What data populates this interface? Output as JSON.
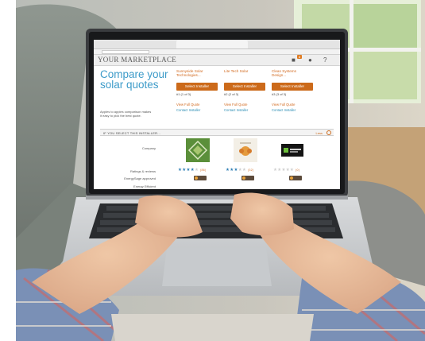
{
  "marketplace": {
    "brand": "YOUR MARKETPLACE",
    "header_icons": [
      "chat-icon",
      "lock-icon",
      "help-icon"
    ],
    "notification_count": "8",
    "title_line1": "Compare your",
    "title_line2": "solar quotes",
    "intro_line1": "Apples to apples comparison makes",
    "intro_line2": "it easy to pick the best quote.",
    "installers": [
      {
        "name_line1": "Sunnyside Solar",
        "name_line2": "Technologies...",
        "select": "Select Installer",
        "rank": "#1 (1 of 3)",
        "view": "View Full Quote",
        "contact": "Contact Installer",
        "stars_filled": 4,
        "reviews": "(86)"
      },
      {
        "name_line1": "Lite Tech Solar",
        "name_line2": "",
        "select": "Select Installer",
        "rank": "#2 (2 of 3)",
        "view": "View Full Quote",
        "contact": "Contact Installer",
        "stars_filled": 3,
        "reviews": "(32)"
      },
      {
        "name_line1": "Clean Systems",
        "name_line2": "Design...",
        "select": "Select Installer",
        "rank": "#3 (3 of 3)",
        "view": "View Full Quote",
        "contact": "Contact Installer",
        "stars_filled": 0,
        "reviews": "(0)"
      }
    ],
    "section_label": "IF YOU SELECT THIS INSTALLER...",
    "less_label": "Less",
    "row_company": "Company",
    "row_ratings": "Ratings & reviews",
    "row_approved": "EnergySage approved",
    "row_cut": "Energy Efficient"
  },
  "colors": {
    "accent_orange": "#cc6a1a",
    "title_blue": "#3d9bc9"
  }
}
